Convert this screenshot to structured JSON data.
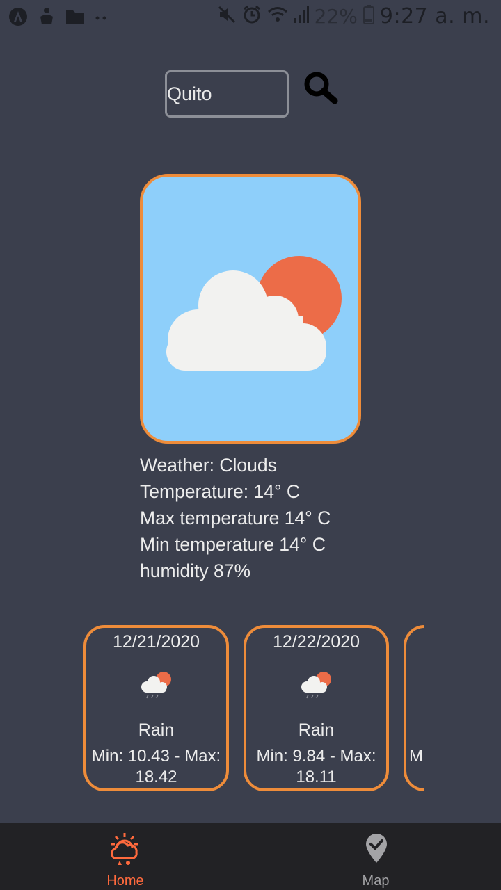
{
  "status_bar": {
    "battery_percent": "22%",
    "time": "9:27 a. m."
  },
  "search": {
    "value": "Quito"
  },
  "current": {
    "icon": "sun-behind-cloud-icon",
    "weather_line": "Weather: Clouds",
    "temperature_line": "Temperature: 14° C",
    "max_line": "Max temperature 14° C",
    "min_line": "Min temperature 14° C",
    "humidity_line": "humidity 87%"
  },
  "forecast": [
    {
      "date": "12/21/2020",
      "icon": "rain-cloud-sun-icon",
      "description": "Rain",
      "range_line1": "Min: 10.43 - Max:",
      "range_line2": "18.42"
    },
    {
      "date": "12/22/2020",
      "icon": "rain-cloud-sun-icon",
      "description": "Rain",
      "range_line1": "Min: 9.84 - Max:",
      "range_line2": "18.11"
    },
    {
      "range_line1": "M"
    }
  ],
  "nav": {
    "home_label": "Home",
    "map_label": "Map",
    "active": "home"
  },
  "colors": {
    "background": "#3b3f4d",
    "accent": "#ee8c3a",
    "sky": "#8ecffa",
    "sun": "#ec6c48",
    "nav_active": "#ff6a3d",
    "nav_inactive": "#a3a3a6"
  }
}
